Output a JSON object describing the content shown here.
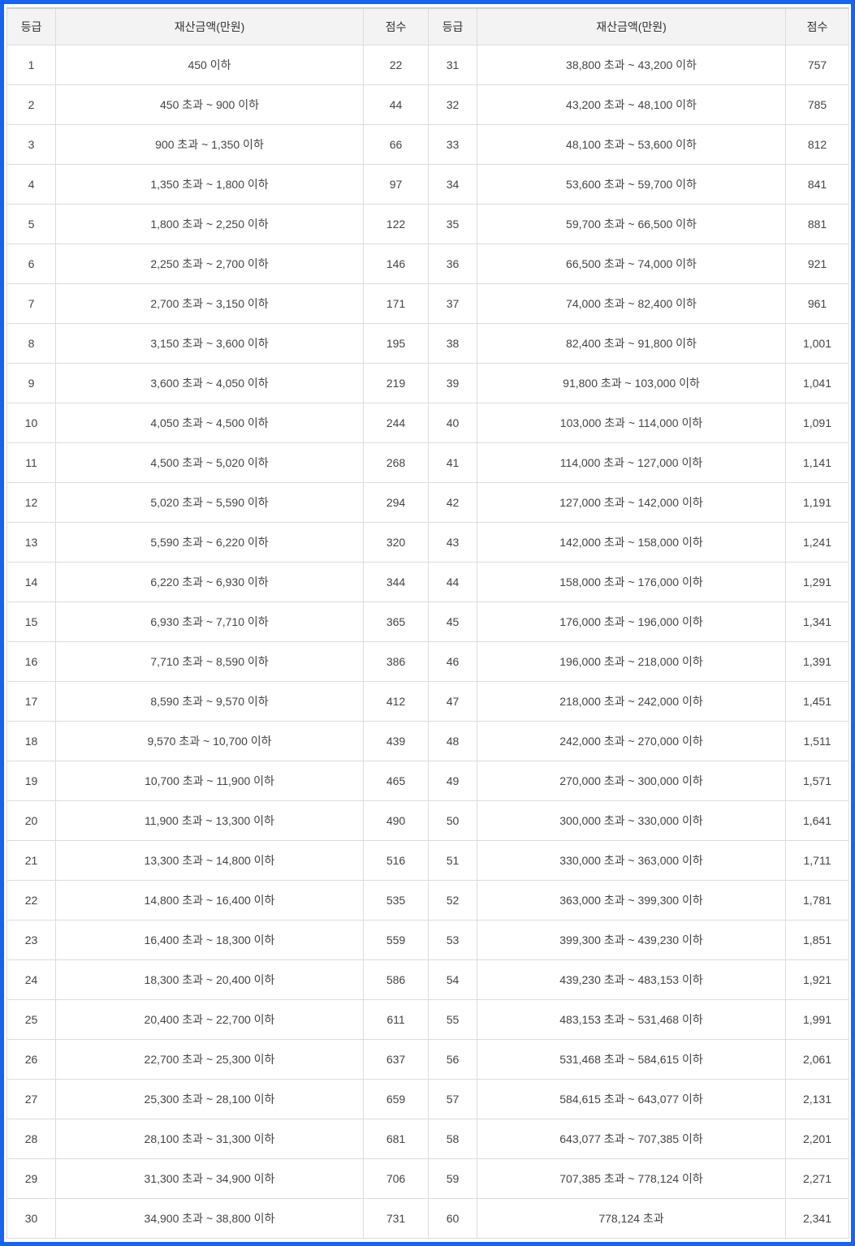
{
  "headers": [
    "등급",
    "재산금액(만원)",
    "점수",
    "등급",
    "재산금액(만원)",
    "점수"
  ],
  "rows": [
    {
      "g1": "1",
      "r1": "450 이하",
      "s1": "22",
      "g2": "31",
      "r2": "38,800 초과 ~ 43,200 이하",
      "s2": "757"
    },
    {
      "g1": "2",
      "r1": "450 초과 ~ 900 이하",
      "s1": "44",
      "g2": "32",
      "r2": "43,200 초과 ~ 48,100 이하",
      "s2": "785"
    },
    {
      "g1": "3",
      "r1": "900 초과 ~ 1,350 이하",
      "s1": "66",
      "g2": "33",
      "r2": "48,100 초과 ~ 53,600 이하",
      "s2": "812"
    },
    {
      "g1": "4",
      "r1": "1,350 초과 ~ 1,800 이하",
      "s1": "97",
      "g2": "34",
      "r2": "53,600 초과 ~ 59,700 이하",
      "s2": "841"
    },
    {
      "g1": "5",
      "r1": "1,800 초과 ~ 2,250 이하",
      "s1": "122",
      "g2": "35",
      "r2": "59,700 초과 ~ 66,500 이하",
      "s2": "881"
    },
    {
      "g1": "6",
      "r1": "2,250 초과 ~ 2,700 이하",
      "s1": "146",
      "g2": "36",
      "r2": "66,500 초과 ~ 74,000 이하",
      "s2": "921"
    },
    {
      "g1": "7",
      "r1": "2,700 초과 ~ 3,150 이하",
      "s1": "171",
      "g2": "37",
      "r2": "74,000 초과 ~ 82,400 이하",
      "s2": "961"
    },
    {
      "g1": "8",
      "r1": "3,150 초과 ~ 3,600 이하",
      "s1": "195",
      "g2": "38",
      "r2": "82,400 초과 ~ 91,800 이하",
      "s2": "1,001"
    },
    {
      "g1": "9",
      "r1": "3,600 초과 ~ 4,050 이하",
      "s1": "219",
      "g2": "39",
      "r2": "91,800 초과 ~ 103,000 이하",
      "s2": "1,041"
    },
    {
      "g1": "10",
      "r1": "4,050 초과 ~ 4,500 이하",
      "s1": "244",
      "g2": "40",
      "r2": "103,000 초과 ~ 114,000 이하",
      "s2": "1,091"
    },
    {
      "g1": "11",
      "r1": "4,500 초과 ~ 5,020 이하",
      "s1": "268",
      "g2": "41",
      "r2": "114,000 초과 ~ 127,000 이하",
      "s2": "1,141"
    },
    {
      "g1": "12",
      "r1": "5,020 초과 ~ 5,590 이하",
      "s1": "294",
      "g2": "42",
      "r2": "127,000 초과 ~ 142,000 이하",
      "s2": "1,191"
    },
    {
      "g1": "13",
      "r1": "5,590 초과 ~ 6,220 이하",
      "s1": "320",
      "g2": "43",
      "r2": "142,000 초과 ~ 158,000 이하",
      "s2": "1,241"
    },
    {
      "g1": "14",
      "r1": "6,220 초과 ~ 6,930 이하",
      "s1": "344",
      "g2": "44",
      "r2": "158,000 초과 ~ 176,000 이하",
      "s2": "1,291"
    },
    {
      "g1": "15",
      "r1": "6,930 초과 ~ 7,710 이하",
      "s1": "365",
      "g2": "45",
      "r2": "176,000 초과 ~ 196,000 이하",
      "s2": "1,341"
    },
    {
      "g1": "16",
      "r1": "7,710 초과 ~ 8,590 이하",
      "s1": "386",
      "g2": "46",
      "r2": "196,000 초과 ~ 218,000 이하",
      "s2": "1,391"
    },
    {
      "g1": "17",
      "r1": "8,590 초과 ~ 9,570 이하",
      "s1": "412",
      "g2": "47",
      "r2": "218,000 초과 ~ 242,000 이하",
      "s2": "1,451"
    },
    {
      "g1": "18",
      "r1": "9,570 초과 ~ 10,700 이하",
      "s1": "439",
      "g2": "48",
      "r2": "242,000 초과 ~ 270,000 이하",
      "s2": "1,511"
    },
    {
      "g1": "19",
      "r1": "10,700 초과 ~ 11,900 이하",
      "s1": "465",
      "g2": "49",
      "r2": "270,000 초과 ~ 300,000 이하",
      "s2": "1,571"
    },
    {
      "g1": "20",
      "r1": "11,900 초과 ~ 13,300 이하",
      "s1": "490",
      "g2": "50",
      "r2": "300,000 초과 ~ 330,000 이하",
      "s2": "1,641"
    },
    {
      "g1": "21",
      "r1": "13,300 초과 ~ 14,800 이하",
      "s1": "516",
      "g2": "51",
      "r2": "330,000 초과 ~ 363,000 이하",
      "s2": "1,711"
    },
    {
      "g1": "22",
      "r1": "14,800 초과 ~ 16,400 이하",
      "s1": "535",
      "g2": "52",
      "r2": "363,000 초과 ~ 399,300 이하",
      "s2": "1,781"
    },
    {
      "g1": "23",
      "r1": "16,400 초과 ~ 18,300 이하",
      "s1": "559",
      "g2": "53",
      "r2": "399,300 초과 ~ 439,230 이하",
      "s2": "1,851"
    },
    {
      "g1": "24",
      "r1": "18,300 초과 ~ 20,400 이하",
      "s1": "586",
      "g2": "54",
      "r2": "439,230 초과 ~ 483,153 이하",
      "s2": "1,921"
    },
    {
      "g1": "25",
      "r1": "20,400 초과 ~ 22,700 이하",
      "s1": "611",
      "g2": "55",
      "r2": "483,153 초과 ~ 531,468 이하",
      "s2": "1,991"
    },
    {
      "g1": "26",
      "r1": "22,700 초과 ~ 25,300 이하",
      "s1": "637",
      "g2": "56",
      "r2": "531,468 초과 ~ 584,615 이하",
      "s2": "2,061"
    },
    {
      "g1": "27",
      "r1": "25,300 초과 ~ 28,100 이하",
      "s1": "659",
      "g2": "57",
      "r2": "584,615 초과 ~ 643,077 이하",
      "s2": "2,131"
    },
    {
      "g1": "28",
      "r1": "28,100 초과 ~ 31,300 이하",
      "s1": "681",
      "g2": "58",
      "r2": "643,077 초과 ~ 707,385 이하",
      "s2": "2,201"
    },
    {
      "g1": "29",
      "r1": "31,300 초과 ~ 34,900 이하",
      "s1": "706",
      "g2": "59",
      "r2": "707,385 초과 ~ 778,124 이하",
      "s2": "2,271"
    },
    {
      "g1": "30",
      "r1": "34,900 초과 ~ 38,800 이하",
      "s1": "731",
      "g2": "60",
      "r2": "778,124 초과",
      "s2": "2,341"
    }
  ],
  "colors": {
    "frame": "#1664f5",
    "header_bg": "#f3f3f3",
    "border": "#dcdcdc"
  }
}
